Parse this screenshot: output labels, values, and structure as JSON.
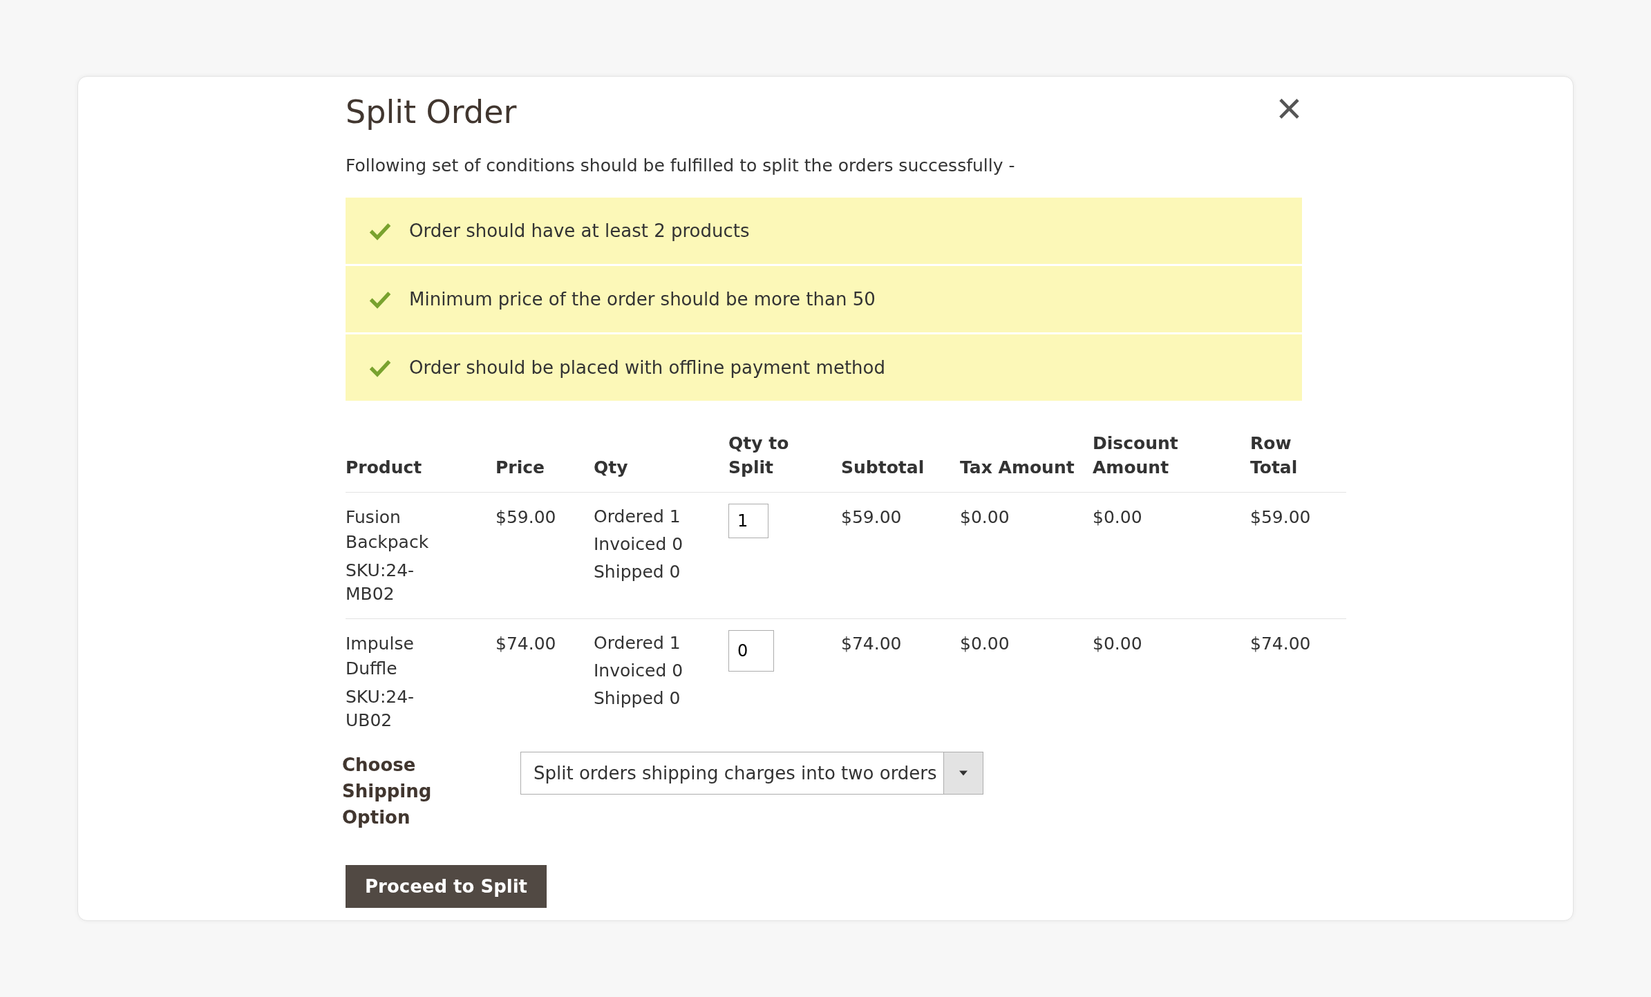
{
  "modal": {
    "title": "Split Order",
    "close_symbol": "×",
    "intro": "Following set of conditions should be fulfilled to split the orders successfully -",
    "conditions": [
      {
        "text": "Order should have at least 2 products",
        "met": true
      },
      {
        "text": "Minimum price of the order should be more than 50",
        "met": true
      },
      {
        "text": "Order should be placed with offline payment method",
        "met": true
      }
    ],
    "table": {
      "columns": [
        "Product",
        "Price",
        "Qty",
        "Qty to Split",
        "Subtotal",
        "Tax Amount",
        "Discount Amount",
        "Row Total"
      ],
      "rows": [
        {
          "product": "Fusion Backpack",
          "sku": "SKU:24-MB02",
          "price": "$59.00",
          "qty": [
            "Ordered 1",
            "Invoiced 0",
            "Shipped 0"
          ],
          "qty_to_split": "1",
          "subtotal": "$59.00",
          "tax": "$0.00",
          "discount": "$0.00",
          "row_total": "$59.00"
        },
        {
          "product": "Impulse Duffle",
          "sku": "SKU:24-UB02",
          "price": "$74.00",
          "qty": [
            "Ordered 1",
            "Invoiced 0",
            "Shipped 0"
          ],
          "qty_to_split": "0",
          "subtotal": "$74.00",
          "tax": "$0.00",
          "discount": "$0.00",
          "row_total": "$74.00"
        }
      ]
    },
    "shipping": {
      "label": "Choose Shipping Option",
      "value": "Split orders shipping charges into two orders"
    },
    "button": "Proceed to Split"
  }
}
